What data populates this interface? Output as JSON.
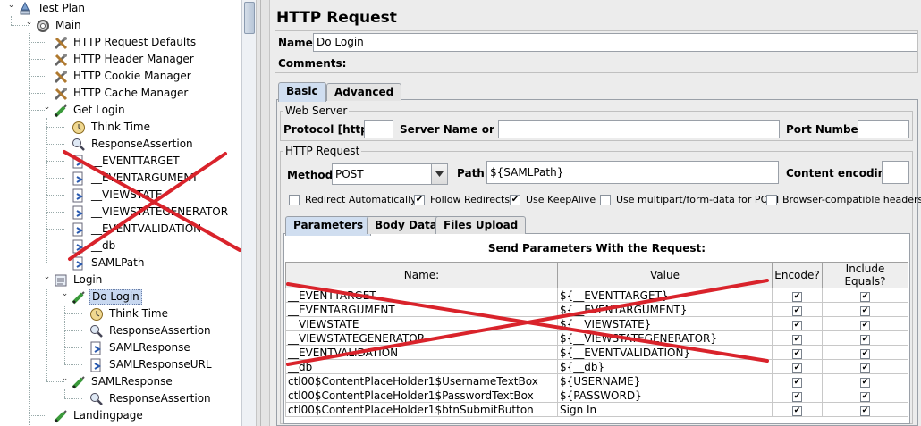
{
  "tree": {
    "nodes": [
      {
        "label": "Test Plan",
        "icon": "test-plan-icon"
      },
      {
        "label": "Main",
        "icon": "thread-group-icon"
      },
      {
        "label": "HTTP Request Defaults",
        "icon": "config-tools-icon"
      },
      {
        "label": "HTTP Header Manager",
        "icon": "config-tools-icon"
      },
      {
        "label": "HTTP Cookie Manager",
        "icon": "config-tools-icon"
      },
      {
        "label": "HTTP Cache Manager",
        "icon": "config-tools-icon"
      },
      {
        "label": "Get Login",
        "icon": "sampler-pen-icon"
      },
      {
        "label": "Think Time",
        "icon": "timer-icon"
      },
      {
        "label": "ResponseAssertion",
        "icon": "magnifier-icon"
      },
      {
        "label": "__EVENTTARGET",
        "icon": "extractor-icon"
      },
      {
        "label": "__EVENTARGUMENT",
        "icon": "extractor-icon"
      },
      {
        "label": "__VIEWSTATE",
        "icon": "extractor-icon"
      },
      {
        "label": "__VIEWSTATEGENERATOR",
        "icon": "extractor-icon"
      },
      {
        "label": "__EVENTVALIDATION",
        "icon": "extractor-icon"
      },
      {
        "label": "__db",
        "icon": "extractor-icon"
      },
      {
        "label": "SAMLPath",
        "icon": "extractor-icon"
      },
      {
        "label": "Login",
        "icon": "controller-icon"
      },
      {
        "label": "Do Login",
        "icon": "sampler-pen-icon"
      },
      {
        "label": "Think Time",
        "icon": "timer-icon"
      },
      {
        "label": "ResponseAssertion",
        "icon": "magnifier-icon"
      },
      {
        "label": "SAMLResponse",
        "icon": "extractor-icon"
      },
      {
        "label": "SAMLResponseURL",
        "icon": "extractor-icon"
      },
      {
        "label": "SAMLResponse",
        "icon": "sampler-pen-icon"
      },
      {
        "label": "ResponseAssertion",
        "icon": "magnifier-icon"
      },
      {
        "label": "Landingpage",
        "icon": "sampler-pen-icon"
      }
    ]
  },
  "panel": {
    "title": "HTTP Request",
    "name_label": "Name:",
    "name_value": "Do Login",
    "comments_label": "Comments:",
    "tabs": [
      "Basic",
      "Advanced"
    ],
    "web_server": {
      "title": "Web Server",
      "protocol_label": "Protocol [http]:",
      "protocol_value": "",
      "server_label": "Server Name or IP:",
      "server_value": "",
      "port_label": "Port Number:",
      "port_value": ""
    },
    "http_request": {
      "title": "HTTP Request",
      "method_label": "Method:",
      "method_value": "POST",
      "path_label": "Path:",
      "path_value": "${SAMLPath}",
      "encoding_label": "Content encoding:",
      "encoding_value": ""
    },
    "options": [
      {
        "label": "Redirect Automatically",
        "checked": false
      },
      {
        "label": "Follow Redirects",
        "checked": true
      },
      {
        "label": "Use KeepAlive",
        "checked": true
      },
      {
        "label": "Use multipart/form-data for POST",
        "checked": false
      },
      {
        "label": "Browser-compatible headers",
        "checked": false
      }
    ],
    "subtabs": [
      "Parameters",
      "Body Data",
      "Files Upload"
    ],
    "params_caption": "Send Parameters With the Request:",
    "columns": [
      "Name:",
      "Value",
      "Encode?",
      "Include Equals?"
    ],
    "rows": [
      {
        "name": "__EVENTTARGET",
        "value": "${__EVENTTARGET}"
      },
      {
        "name": "__EVENTARGUMENT",
        "value": "${__EVENTARGUMENT}"
      },
      {
        "name": "__VIEWSTATE",
        "value": "${__VIEWSTATE}"
      },
      {
        "name": "__VIEWSTATEGENERATOR",
        "value": "${__VIEWSTATEGENERATOR}"
      },
      {
        "name": "__EVENTVALIDATION",
        "value": "${__EVENTVALIDATION}"
      },
      {
        "name": "__db",
        "value": "${__db}"
      },
      {
        "name": "ctl00$ContentPlaceHolder1$UsernameTextBox",
        "value": "${USERNAME}"
      },
      {
        "name": "ctl00$ContentPlaceHolder1$PasswordTextBox",
        "value": "${PASSWORD}"
      },
      {
        "name": "ctl00$ContentPlaceHolder1$btnSubmitButton",
        "value": "Sign In"
      }
    ],
    "check_mark": "✔"
  },
  "colors": {
    "cross": "#d9232b",
    "selection": "#c8d8f0"
  }
}
